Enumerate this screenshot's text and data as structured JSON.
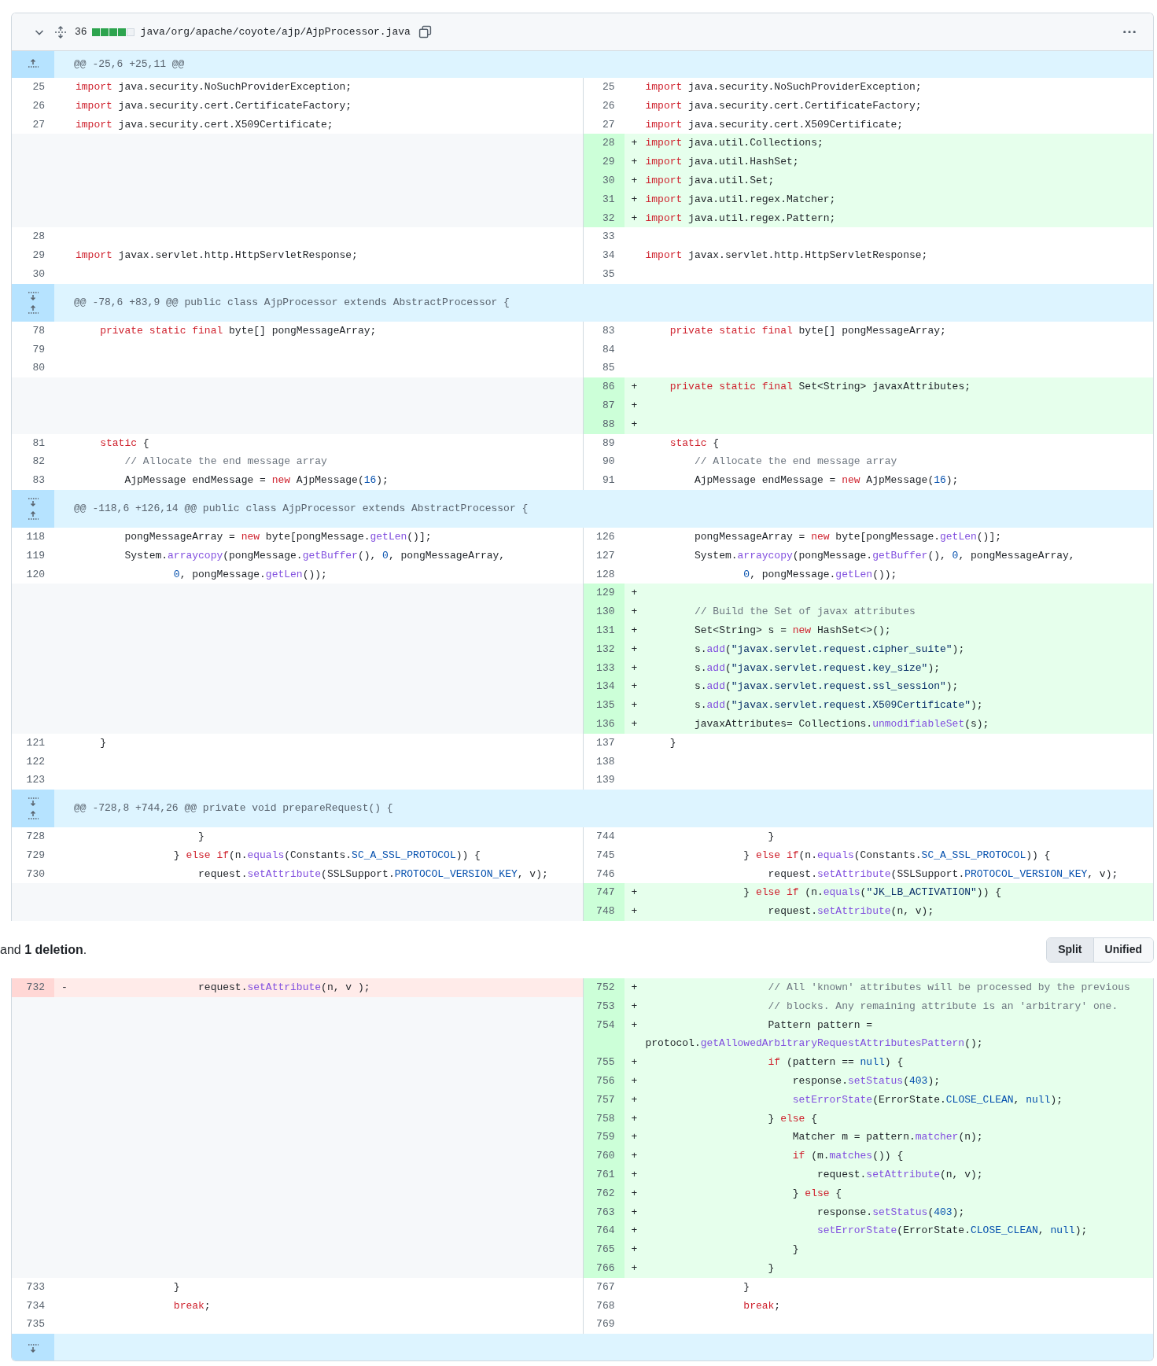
{
  "file_header": {
    "expanded": true,
    "changes": "36",
    "diffstat": [
      {
        "kind": "added"
      },
      {
        "kind": "added"
      },
      {
        "kind": "added"
      },
      {
        "kind": "added"
      },
      {
        "kind": "neutral"
      }
    ],
    "path": "java/org/apache/coyote/ajp/AjpProcessor.java"
  },
  "diff_top": [
    {
      "kind": "hunk",
      "expand_up": true,
      "expand_down": false,
      "text": "@@ -25,6 +25,11 @@"
    },
    {
      "kind": "line",
      "left": {
        "num": "25",
        "kind": "context",
        "code": [
          {
            "kind": "keyword",
            "text": "import"
          },
          {
            "kind": "plain",
            "text": " java.security.NoSuchProviderException;"
          }
        ]
      },
      "right": {
        "num": "25",
        "kind": "context",
        "code": [
          {
            "kind": "keyword",
            "text": "import"
          },
          {
            "kind": "plain",
            "text": " java.security.NoSuchProviderException;"
          }
        ]
      }
    },
    {
      "kind": "line",
      "left": {
        "num": "26",
        "kind": "context",
        "code": [
          {
            "kind": "keyword",
            "text": "import"
          },
          {
            "kind": "plain",
            "text": " java.security.cert.CertificateFactory;"
          }
        ]
      },
      "right": {
        "num": "26",
        "kind": "context",
        "code": [
          {
            "kind": "keyword",
            "text": "import"
          },
          {
            "kind": "plain",
            "text": " java.security.cert.CertificateFactory;"
          }
        ]
      }
    },
    {
      "kind": "line",
      "left": {
        "num": "27",
        "kind": "context",
        "code": [
          {
            "kind": "keyword",
            "text": "import"
          },
          {
            "kind": "plain",
            "text": " java.security.cert.X509Certificate;"
          }
        ]
      },
      "right": {
        "num": "27",
        "kind": "context",
        "code": [
          {
            "kind": "keyword",
            "text": "import"
          },
          {
            "kind": "plain",
            "text": " java.security.cert.X509Certificate;"
          }
        ]
      }
    },
    {
      "kind": "line",
      "right": {
        "num": "28",
        "kind": "added",
        "sign": "+",
        "code": [
          {
            "kind": "keyword",
            "text": "import"
          },
          {
            "kind": "plain",
            "text": " java.util.Collections;"
          }
        ]
      }
    },
    {
      "kind": "line",
      "right": {
        "num": "29",
        "kind": "added",
        "sign": "+",
        "code": [
          {
            "kind": "keyword",
            "text": "import"
          },
          {
            "kind": "plain",
            "text": " java.util.HashSet;"
          }
        ]
      }
    },
    {
      "kind": "line",
      "right": {
        "num": "30",
        "kind": "added",
        "sign": "+",
        "code": [
          {
            "kind": "keyword",
            "text": "import"
          },
          {
            "kind": "plain",
            "text": " java.util.Set;"
          }
        ]
      }
    },
    {
      "kind": "line",
      "right": {
        "num": "31",
        "kind": "added",
        "sign": "+",
        "code": [
          {
            "kind": "keyword",
            "text": "import"
          },
          {
            "kind": "plain",
            "text": " java.util.regex.Matcher;"
          }
        ]
      }
    },
    {
      "kind": "line",
      "right": {
        "num": "32",
        "kind": "added",
        "sign": "+",
        "code": [
          {
            "kind": "keyword",
            "text": "import"
          },
          {
            "kind": "plain",
            "text": " java.util.regex.Pattern;"
          }
        ]
      }
    },
    {
      "kind": "line",
      "left": {
        "num": "28",
        "kind": "context"
      },
      "right": {
        "num": "33",
        "kind": "context"
      }
    },
    {
      "kind": "line",
      "left": {
        "num": "29",
        "kind": "context",
        "code": [
          {
            "kind": "keyword",
            "text": "import"
          },
          {
            "kind": "plain",
            "text": " javax.servlet.http.HttpServletResponse;"
          }
        ]
      },
      "right": {
        "num": "34",
        "kind": "context",
        "code": [
          {
            "kind": "keyword",
            "text": "import"
          },
          {
            "kind": "plain",
            "text": " javax.servlet.http.HttpServletResponse;"
          }
        ]
      }
    },
    {
      "kind": "line",
      "left": {
        "num": "30",
        "kind": "context"
      },
      "right": {
        "num": "35",
        "kind": "context"
      }
    },
    {
      "kind": "hunk",
      "expand_up": true,
      "expand_down": true,
      "text": "@@ -78,6 +83,9 @@ public class AjpProcessor extends AbstractProcessor {"
    },
    {
      "kind": "line",
      "left": {
        "num": "78",
        "kind": "context",
        "code": [
          {
            "kind": "keyword",
            "text": "    private static final"
          },
          {
            "kind": "plain",
            "text": " byte[] pongMessageArray;"
          }
        ]
      },
      "right": {
        "num": "83",
        "kind": "context",
        "code": [
          {
            "kind": "keyword",
            "text": "    private static final"
          },
          {
            "kind": "plain",
            "text": " byte[] pongMessageArray;"
          }
        ]
      }
    },
    {
      "kind": "line",
      "left": {
        "num": "79",
        "kind": "context"
      },
      "right": {
        "num": "84",
        "kind": "context"
      }
    },
    {
      "kind": "line",
      "left": {
        "num": "80",
        "kind": "context"
      },
      "right": {
        "num": "85",
        "kind": "context"
      }
    },
    {
      "kind": "line",
      "right": {
        "num": "86",
        "kind": "added",
        "sign": "+",
        "code": [
          {
            "kind": "keyword",
            "text": "    private static final"
          },
          {
            "kind": "plain",
            "text": " Set<String> javaxAttributes;"
          }
        ]
      }
    },
    {
      "kind": "line",
      "right": {
        "num": "87",
        "kind": "added",
        "sign": "+"
      }
    },
    {
      "kind": "line",
      "right": {
        "num": "88",
        "kind": "added",
        "sign": "+"
      }
    },
    {
      "kind": "line",
      "left": {
        "num": "81",
        "kind": "context",
        "code": [
          {
            "kind": "keyword",
            "text": "    static"
          },
          {
            "kind": "plain",
            "text": " {"
          }
        ]
      },
      "right": {
        "num": "89",
        "kind": "context",
        "code": [
          {
            "kind": "keyword",
            "text": "    static"
          },
          {
            "kind": "plain",
            "text": " {"
          }
        ]
      }
    },
    {
      "kind": "line",
      "left": {
        "num": "82",
        "kind": "context",
        "code": [
          {
            "kind": "comment",
            "text": "        // Allocate the end message array"
          }
        ]
      },
      "right": {
        "num": "90",
        "kind": "context",
        "code": [
          {
            "kind": "comment",
            "text": "        // Allocate the end message array"
          }
        ]
      }
    },
    {
      "kind": "line",
      "left": {
        "num": "83",
        "kind": "context",
        "code": [
          {
            "kind": "plain",
            "text": "        AjpMessage endMessage = "
          },
          {
            "kind": "keyword",
            "text": "new"
          },
          {
            "kind": "plain",
            "text": " AjpMessage("
          },
          {
            "kind": "constant",
            "text": "16"
          },
          {
            "kind": "plain",
            "text": ");"
          }
        ]
      },
      "right": {
        "num": "91",
        "kind": "context",
        "code": [
          {
            "kind": "plain",
            "text": "        AjpMessage endMessage = "
          },
          {
            "kind": "keyword",
            "text": "new"
          },
          {
            "kind": "plain",
            "text": " AjpMessage("
          },
          {
            "kind": "constant",
            "text": "16"
          },
          {
            "kind": "plain",
            "text": ");"
          }
        ]
      }
    },
    {
      "kind": "hunk",
      "expand_up": true,
      "expand_down": true,
      "text": "@@ -118,6 +126,14 @@ public class AjpProcessor extends AbstractProcessor {"
    },
    {
      "kind": "line",
      "left": {
        "num": "118",
        "kind": "context",
        "code": [
          {
            "kind": "plain",
            "text": "        pongMessageArray = "
          },
          {
            "kind": "keyword",
            "text": "new"
          },
          {
            "kind": "plain",
            "text": " byte[pongMessage."
          },
          {
            "kind": "function",
            "text": "getLen"
          },
          {
            "kind": "plain",
            "text": "()];"
          }
        ]
      },
      "right": {
        "num": "126",
        "kind": "context",
        "code": [
          {
            "kind": "plain",
            "text": "        pongMessageArray = "
          },
          {
            "kind": "keyword",
            "text": "new"
          },
          {
            "kind": "plain",
            "text": " byte[pongMessage."
          },
          {
            "kind": "function",
            "text": "getLen"
          },
          {
            "kind": "plain",
            "text": "()];"
          }
        ]
      }
    },
    {
      "kind": "line",
      "left": {
        "num": "119",
        "kind": "context",
        "code": [
          {
            "kind": "plain",
            "text": "        System."
          },
          {
            "kind": "function",
            "text": "arraycopy"
          },
          {
            "kind": "plain",
            "text": "(pongMessage."
          },
          {
            "kind": "function",
            "text": "getBuffer"
          },
          {
            "kind": "plain",
            "text": "(), "
          },
          {
            "kind": "constant",
            "text": "0"
          },
          {
            "kind": "plain",
            "text": ", pongMessageArray,"
          }
        ]
      },
      "right": {
        "num": "127",
        "kind": "context",
        "code": [
          {
            "kind": "plain",
            "text": "        System."
          },
          {
            "kind": "function",
            "text": "arraycopy"
          },
          {
            "kind": "plain",
            "text": "(pongMessage."
          },
          {
            "kind": "function",
            "text": "getBuffer"
          },
          {
            "kind": "plain",
            "text": "(), "
          },
          {
            "kind": "constant",
            "text": "0"
          },
          {
            "kind": "plain",
            "text": ", pongMessageArray,"
          }
        ]
      }
    },
    {
      "kind": "line",
      "left": {
        "num": "120",
        "kind": "context",
        "code": [
          {
            "kind": "constant",
            "text": "                0"
          },
          {
            "kind": "plain",
            "text": ", pongMessage."
          },
          {
            "kind": "function",
            "text": "getLen"
          },
          {
            "kind": "plain",
            "text": "());"
          }
        ]
      },
      "right": {
        "num": "128",
        "kind": "context",
        "code": [
          {
            "kind": "constant",
            "text": "                0"
          },
          {
            "kind": "plain",
            "text": ", pongMessage."
          },
          {
            "kind": "function",
            "text": "getLen"
          },
          {
            "kind": "plain",
            "text": "());"
          }
        ]
      }
    },
    {
      "kind": "line",
      "right": {
        "num": "129",
        "kind": "added",
        "sign": "+"
      }
    },
    {
      "kind": "line",
      "right": {
        "num": "130",
        "kind": "added",
        "sign": "+",
        "code": [
          {
            "kind": "comment",
            "text": "        // Build the Set of javax attributes"
          }
        ]
      }
    },
    {
      "kind": "line",
      "right": {
        "num": "131",
        "kind": "added",
        "sign": "+",
        "code": [
          {
            "kind": "plain",
            "text": "        Set<String> s = "
          },
          {
            "kind": "keyword",
            "text": "new"
          },
          {
            "kind": "plain",
            "text": " HashSet<>();"
          }
        ]
      }
    },
    {
      "kind": "line",
      "right": {
        "num": "132",
        "kind": "added",
        "sign": "+",
        "code": [
          {
            "kind": "plain",
            "text": "        s."
          },
          {
            "kind": "function",
            "text": "add"
          },
          {
            "kind": "plain",
            "text": "("
          },
          {
            "kind": "string",
            "text": "\"javax.servlet.request.cipher_suite\""
          },
          {
            "kind": "plain",
            "text": ");"
          }
        ]
      }
    },
    {
      "kind": "line",
      "right": {
        "num": "133",
        "kind": "added",
        "sign": "+",
        "code": [
          {
            "kind": "plain",
            "text": "        s."
          },
          {
            "kind": "function",
            "text": "add"
          },
          {
            "kind": "plain",
            "text": "("
          },
          {
            "kind": "string",
            "text": "\"javax.servlet.request.key_size\""
          },
          {
            "kind": "plain",
            "text": ");"
          }
        ]
      }
    },
    {
      "kind": "line",
      "right": {
        "num": "134",
        "kind": "added",
        "sign": "+",
        "code": [
          {
            "kind": "plain",
            "text": "        s."
          },
          {
            "kind": "function",
            "text": "add"
          },
          {
            "kind": "plain",
            "text": "("
          },
          {
            "kind": "string",
            "text": "\"javax.servlet.request.ssl_session\""
          },
          {
            "kind": "plain",
            "text": ");"
          }
        ]
      }
    },
    {
      "kind": "line",
      "right": {
        "num": "135",
        "kind": "added",
        "sign": "+",
        "code": [
          {
            "kind": "plain",
            "text": "        s."
          },
          {
            "kind": "function",
            "text": "add"
          },
          {
            "kind": "plain",
            "text": "("
          },
          {
            "kind": "string",
            "text": "\"javax.servlet.request.X509Certificate\""
          },
          {
            "kind": "plain",
            "text": ");"
          }
        ]
      }
    },
    {
      "kind": "line",
      "right": {
        "num": "136",
        "kind": "added",
        "sign": "+",
        "code": [
          {
            "kind": "plain",
            "text": "        javaxAttributes= Collections."
          },
          {
            "kind": "function",
            "text": "unmodifiableSet"
          },
          {
            "kind": "plain",
            "text": "(s);"
          }
        ]
      }
    },
    {
      "kind": "line",
      "left": {
        "num": "121",
        "kind": "context",
        "code": [
          {
            "kind": "plain",
            "text": "    }"
          }
        ]
      },
      "right": {
        "num": "137",
        "kind": "context",
        "code": [
          {
            "kind": "plain",
            "text": "    }"
          }
        ]
      }
    },
    {
      "kind": "line",
      "left": {
        "num": "122",
        "kind": "context"
      },
      "right": {
        "num": "138",
        "kind": "context"
      }
    },
    {
      "kind": "line",
      "left": {
        "num": "123",
        "kind": "context"
      },
      "right": {
        "num": "139",
        "kind": "context"
      }
    },
    {
      "kind": "hunk",
      "expand_up": true,
      "expand_down": true,
      "text": "@@ -728,8 +744,26 @@ private void prepareRequest() {"
    },
    {
      "kind": "line",
      "left": {
        "num": "728",
        "kind": "context",
        "code": [
          {
            "kind": "plain",
            "text": "                    }"
          }
        ]
      },
      "right": {
        "num": "744",
        "kind": "context",
        "code": [
          {
            "kind": "plain",
            "text": "                    }"
          }
        ]
      }
    },
    {
      "kind": "line",
      "left": {
        "num": "729",
        "kind": "context",
        "code": [
          {
            "kind": "plain",
            "text": "                } "
          },
          {
            "kind": "keyword",
            "text": "else if"
          },
          {
            "kind": "plain",
            "text": "(n."
          },
          {
            "kind": "function",
            "text": "equals"
          },
          {
            "kind": "plain",
            "text": "(Constants."
          },
          {
            "kind": "constant",
            "text": "SC_A_SSL_PROTOCOL"
          },
          {
            "kind": "plain",
            "text": ")) {"
          }
        ]
      },
      "right": {
        "num": "745",
        "kind": "context",
        "code": [
          {
            "kind": "plain",
            "text": "                } "
          },
          {
            "kind": "keyword",
            "text": "else if"
          },
          {
            "kind": "plain",
            "text": "(n."
          },
          {
            "kind": "function",
            "text": "equals"
          },
          {
            "kind": "plain",
            "text": "(Constants."
          },
          {
            "kind": "constant",
            "text": "SC_A_SSL_PROTOCOL"
          },
          {
            "kind": "plain",
            "text": ")) {"
          }
        ]
      }
    },
    {
      "kind": "line",
      "left": {
        "num": "730",
        "kind": "context",
        "code": [
          {
            "kind": "plain",
            "text": "                    request."
          },
          {
            "kind": "function",
            "text": "setAttribute"
          },
          {
            "kind": "plain",
            "text": "(SSLSupport."
          },
          {
            "kind": "constant",
            "text": "PROTOCOL_VERSION_KEY"
          },
          {
            "kind": "plain",
            "text": ", v);"
          }
        ]
      },
      "right": {
        "num": "746",
        "kind": "context",
        "code": [
          {
            "kind": "plain",
            "text": "                    request."
          },
          {
            "kind": "function",
            "text": "setAttribute"
          },
          {
            "kind": "plain",
            "text": "(SSLSupport."
          },
          {
            "kind": "constant",
            "text": "PROTOCOL_VERSION_KEY"
          },
          {
            "kind": "plain",
            "text": ", v);"
          }
        ]
      }
    },
    {
      "kind": "line",
      "right": {
        "num": "747",
        "kind": "added",
        "sign": "+",
        "code": [
          {
            "kind": "plain",
            "text": "                } "
          },
          {
            "kind": "keyword",
            "text": "else if"
          },
          {
            "kind": "plain",
            "text": " (n."
          },
          {
            "kind": "function",
            "text": "equals"
          },
          {
            "kind": "plain",
            "text": "("
          },
          {
            "kind": "string",
            "text": "\"JK_LB_ACTIVATION\""
          },
          {
            "kind": "plain",
            "text": ")) {"
          }
        ]
      }
    },
    {
      "kind": "line",
      "right": {
        "num": "748",
        "kind": "added",
        "sign": "+",
        "code": [
          {
            "kind": "plain",
            "text": "                    request."
          },
          {
            "kind": "function",
            "text": "setAttribute"
          },
          {
            "kind": "plain",
            "text": "(n, v);"
          }
        ]
      }
    }
  ],
  "summary": {
    "text": "and **1 deletion**.",
    "view_toggle": [
      {
        "label": "Split",
        "selected": true
      },
      {
        "label": "Unified",
        "selected": false
      }
    ]
  },
  "diff_bottom": [
    {
      "kind": "line",
      "left": {
        "num": "732",
        "kind": "deleted",
        "sign": "-",
        "code": [
          {
            "kind": "plain",
            "text": "                    request."
          },
          {
            "kind": "function",
            "text": "setAttribute"
          },
          {
            "kind": "plain",
            "text": "(n, v );"
          }
        ]
      },
      "right": {
        "num": "752",
        "kind": "added",
        "sign": "+",
        "code": [
          {
            "kind": "comment",
            "text": "                    // All 'known' attributes will be processed by the previous"
          }
        ]
      }
    },
    {
      "kind": "line",
      "right": {
        "num": "753",
        "kind": "added",
        "sign": "+",
        "code": [
          {
            "kind": "comment",
            "text": "                    // blocks. Any remaining attribute is an 'arbitrary' one."
          }
        ]
      }
    },
    {
      "kind": "line",
      "right": {
        "num": "754",
        "kind": "added",
        "sign": "+",
        "code": [
          {
            "kind": "plain",
            "text": "                    Pattern pattern = protocol."
          },
          {
            "kind": "function",
            "text": "getAllowedArbitraryRequestAttributesPattern"
          },
          {
            "kind": "plain",
            "text": "();"
          }
        ]
      }
    },
    {
      "kind": "line",
      "right": {
        "num": "755",
        "kind": "added",
        "sign": "+",
        "code": [
          {
            "kind": "keyword",
            "text": "                    if"
          },
          {
            "kind": "plain",
            "text": " (pattern == "
          },
          {
            "kind": "constant",
            "text": "null"
          },
          {
            "kind": "plain",
            "text": ") {"
          }
        ]
      }
    },
    {
      "kind": "line",
      "right": {
        "num": "756",
        "kind": "added",
        "sign": "+",
        "code": [
          {
            "kind": "plain",
            "text": "                        response."
          },
          {
            "kind": "function",
            "text": "setStatus"
          },
          {
            "kind": "plain",
            "text": "("
          },
          {
            "kind": "constant",
            "text": "403"
          },
          {
            "kind": "plain",
            "text": ");"
          }
        ]
      }
    },
    {
      "kind": "line",
      "right": {
        "num": "757",
        "kind": "added",
        "sign": "+",
        "code": [
          {
            "kind": "function",
            "text": "                        setErrorState"
          },
          {
            "kind": "plain",
            "text": "(ErrorState."
          },
          {
            "kind": "constant",
            "text": "CLOSE_CLEAN"
          },
          {
            "kind": "plain",
            "text": ", "
          },
          {
            "kind": "constant",
            "text": "null"
          },
          {
            "kind": "plain",
            "text": ");"
          }
        ]
      }
    },
    {
      "kind": "line",
      "right": {
        "num": "758",
        "kind": "added",
        "sign": "+",
        "code": [
          {
            "kind": "plain",
            "text": "                    } "
          },
          {
            "kind": "keyword",
            "text": "else"
          },
          {
            "kind": "plain",
            "text": " {"
          }
        ]
      }
    },
    {
      "kind": "line",
      "right": {
        "num": "759",
        "kind": "added",
        "sign": "+",
        "code": [
          {
            "kind": "plain",
            "text": "                        Matcher m = pattern."
          },
          {
            "kind": "function",
            "text": "matcher"
          },
          {
            "kind": "plain",
            "text": "(n);"
          }
        ]
      }
    },
    {
      "kind": "line",
      "right": {
        "num": "760",
        "kind": "added",
        "sign": "+",
        "code": [
          {
            "kind": "keyword",
            "text": "                        if"
          },
          {
            "kind": "plain",
            "text": " (m."
          },
          {
            "kind": "function",
            "text": "matches"
          },
          {
            "kind": "plain",
            "text": "()) {"
          }
        ]
      }
    },
    {
      "kind": "line",
      "right": {
        "num": "761",
        "kind": "added",
        "sign": "+",
        "code": [
          {
            "kind": "plain",
            "text": "                            request."
          },
          {
            "kind": "function",
            "text": "setAttribute"
          },
          {
            "kind": "plain",
            "text": "(n, v);"
          }
        ]
      }
    },
    {
      "kind": "line",
      "right": {
        "num": "762",
        "kind": "added",
        "sign": "+",
        "code": [
          {
            "kind": "plain",
            "text": "                        } "
          },
          {
            "kind": "keyword",
            "text": "else"
          },
          {
            "kind": "plain",
            "text": " {"
          }
        ]
      }
    },
    {
      "kind": "line",
      "right": {
        "num": "763",
        "kind": "added",
        "sign": "+",
        "code": [
          {
            "kind": "plain",
            "text": "                            response."
          },
          {
            "kind": "function",
            "text": "setStatus"
          },
          {
            "kind": "plain",
            "text": "("
          },
          {
            "kind": "constant",
            "text": "403"
          },
          {
            "kind": "plain",
            "text": ");"
          }
        ]
      }
    },
    {
      "kind": "line",
      "right": {
        "num": "764",
        "kind": "added",
        "sign": "+",
        "code": [
          {
            "kind": "function",
            "text": "                            setErrorState"
          },
          {
            "kind": "plain",
            "text": "(ErrorState."
          },
          {
            "kind": "constant",
            "text": "CLOSE_CLEAN"
          },
          {
            "kind": "plain",
            "text": ", "
          },
          {
            "kind": "constant",
            "text": "null"
          },
          {
            "kind": "plain",
            "text": ");"
          }
        ]
      }
    },
    {
      "kind": "line",
      "right": {
        "num": "765",
        "kind": "added",
        "sign": "+",
        "code": [
          {
            "kind": "plain",
            "text": "                        }"
          }
        ]
      }
    },
    {
      "kind": "line",
      "right": {
        "num": "766",
        "kind": "added",
        "sign": "+",
        "code": [
          {
            "kind": "plain",
            "text": "                    }"
          }
        ]
      }
    },
    {
      "kind": "line",
      "left": {
        "num": "733",
        "kind": "context",
        "code": [
          {
            "kind": "plain",
            "text": "                }"
          }
        ]
      },
      "right": {
        "num": "767",
        "kind": "context",
        "code": [
          {
            "kind": "plain",
            "text": "                }"
          }
        ]
      }
    },
    {
      "kind": "line",
      "left": {
        "num": "734",
        "kind": "context",
        "code": [
          {
            "kind": "keyword",
            "text": "                break"
          },
          {
            "kind": "plain",
            "text": ";"
          }
        ]
      },
      "right": {
        "num": "768",
        "kind": "context",
        "code": [
          {
            "kind": "keyword",
            "text": "                break"
          },
          {
            "kind": "plain",
            "text": ";"
          }
        ]
      }
    },
    {
      "kind": "line",
      "left": {
        "num": "735",
        "kind": "context"
      },
      "right": {
        "num": "769",
        "kind": "context"
      }
    },
    {
      "kind": "hunk",
      "expand_up": false,
      "expand_down": true
    }
  ]
}
